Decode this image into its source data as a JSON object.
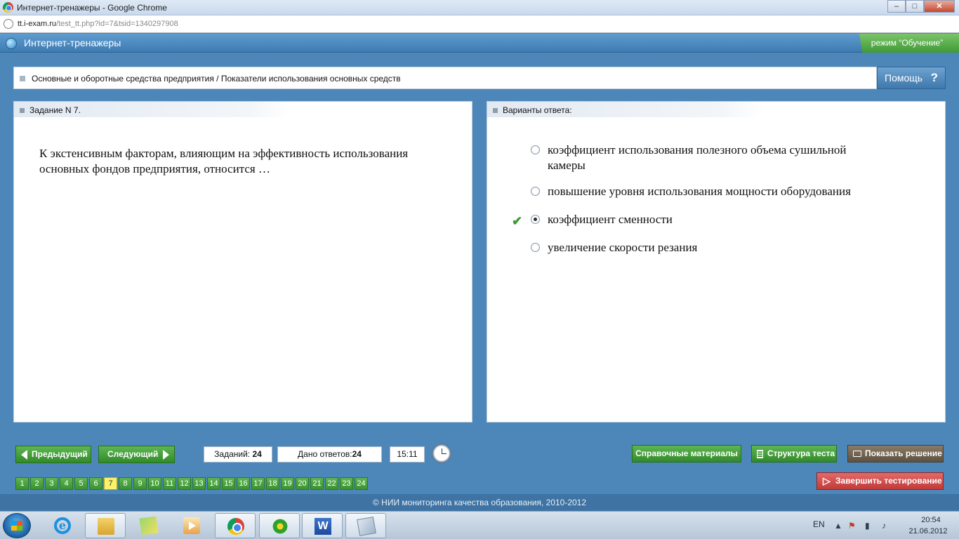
{
  "browser": {
    "window_title": "Интернет-тренажеры - Google Chrome",
    "url_host": "tt.i-exam.ru",
    "url_path": "/test_tt.php?id=7&tsid=1340297908",
    "controls": {
      "minimize": "–",
      "maximize": "□",
      "close": "✕"
    }
  },
  "header": {
    "app_title": "Интернет-тренажеры",
    "mode_badge": "режим “Обучение”"
  },
  "breadcrumb": {
    "text": "Основные и оборотные средства предприятия / Показатели использования основных средств",
    "help_label": "Помощь",
    "help_icon": "?"
  },
  "task": {
    "heading": "Задание N 7.",
    "question": "К экстенсивным факторам, влияющим на эффективность использования основных фондов предприятия, относится …"
  },
  "answers": {
    "heading": "Варианты ответа:",
    "correct_mark": "✔",
    "options": [
      {
        "label": "коэффициент использования полезного объема сушильной камеры",
        "selected": false
      },
      {
        "label": "повышение уровня использования мощности оборудования",
        "selected": false
      },
      {
        "label": "коэффициент сменности",
        "selected": true
      },
      {
        "label": "увеличение скорости резания",
        "selected": false
      }
    ]
  },
  "controls": {
    "prev_label": "Предыдущий",
    "next_label": "Следующий",
    "tasks_label": "Заданий:",
    "tasks_count": "24",
    "answered_label": "Дано ответов:",
    "answered_count": "24",
    "timer": "15:11",
    "reference_label": "Справочные материалы",
    "structure_label": "Структура теста",
    "solution_label": "Показать решение",
    "finish_label": "Завершить тестирование",
    "pages": [
      "1",
      "2",
      "3",
      "4",
      "5",
      "6",
      "7",
      "8",
      "9",
      "10",
      "11",
      "12",
      "13",
      "14",
      "15",
      "16",
      "17",
      "18",
      "19",
      "20",
      "21",
      "22",
      "23",
      "24"
    ],
    "current_page": "7"
  },
  "footer": {
    "copyright": "© НИИ мониторинга качества образования, 2010-2012"
  },
  "taskbar": {
    "lang": "EN",
    "time": "20:54",
    "date": "21.06.2012",
    "word_glyph": "W"
  },
  "colors": {
    "header_blue": "#4d86b8",
    "accent_green": "#3f9a35",
    "finish_red": "#c13a38",
    "current_page_yellow": "#f7f36a"
  }
}
